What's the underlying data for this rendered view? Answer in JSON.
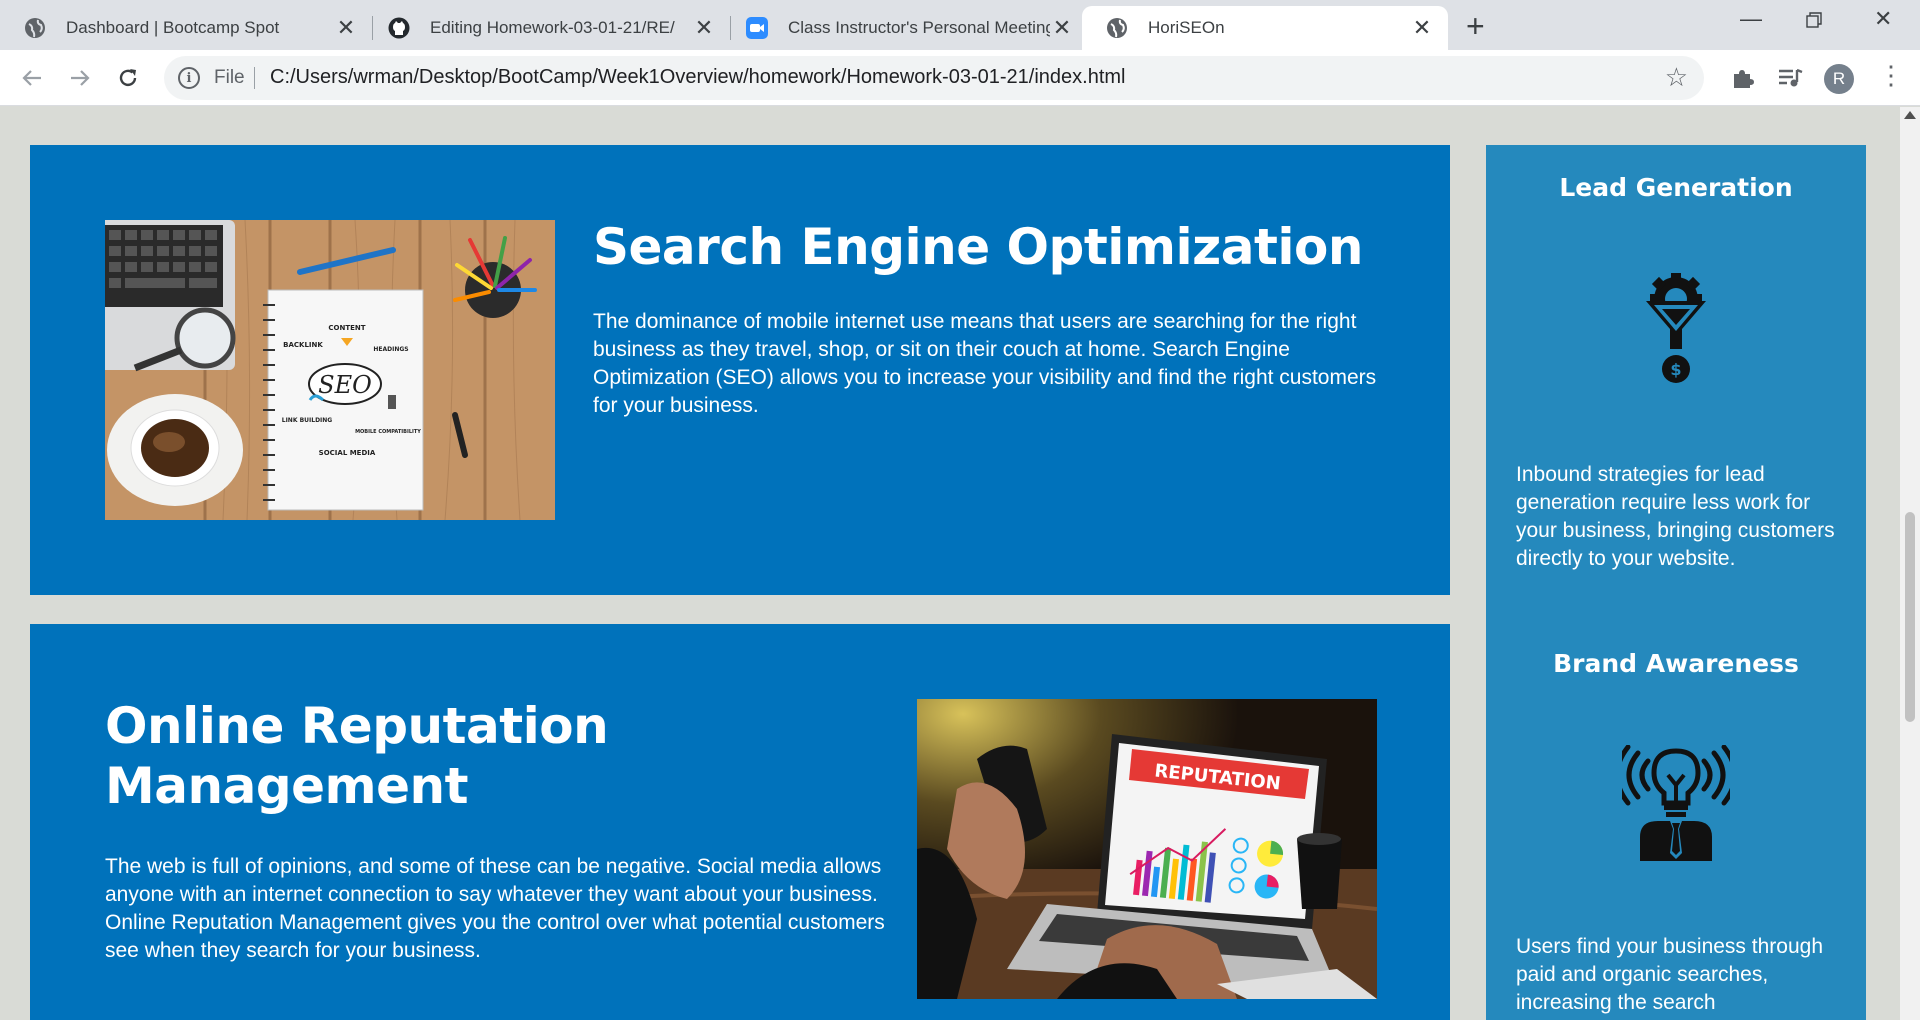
{
  "tabs": [
    {
      "title": "Dashboard | Bootcamp Spot",
      "icon": "globe-icon"
    },
    {
      "title": "Editing Homework-03-01-21/RE/",
      "icon": "github-icon"
    },
    {
      "title": "Class Instructor's Personal Meeting",
      "icon": "zoom-icon"
    },
    {
      "title": "HoriSEOn",
      "icon": "globe-icon"
    }
  ],
  "toolbar": {
    "file_label": "File",
    "url": "C:/Users/wrman/Desktop/BootCamp/Week1Overview/homework/Homework-03-01-21/index.html",
    "avatar_initial": "R"
  },
  "content": {
    "seo": {
      "title": "Search Engine Optimization",
      "text": "The dominance of mobile internet use means that users are searching for the right business as they travel, shop, or sit on their couch at home. Search Engine Optimization (SEO) allows you to increase your visibility and find the right customers for your business.",
      "image_words": [
        "CONTENT",
        "BACKLINK",
        "HEADINGS",
        "SEO",
        "LINK BUILDING",
        "MOBILE COMPATIBILITY",
        "SOCIAL MEDIA"
      ]
    },
    "orm": {
      "title_line1": "Online Reputation",
      "title_line2": "Management",
      "text": "The web is full of opinions, and some of these can be negative. Social media allows anyone with an internet connection to say whatever they want about your business. Online Reputation Management gives you the control over what potential customers see when they search for your business.",
      "image_word": "REPUTATION"
    }
  },
  "sidebar": {
    "lead": {
      "title": "Lead Generation",
      "icon": "lead-funnel-icon",
      "text": "Inbound strategies for lead generation require less work for your business, bringing customers directly to your website."
    },
    "brand": {
      "title": "Brand Awareness",
      "icon": "idea-broadcast-icon",
      "text": "Users find your business through paid and organic searches, increasing the search"
    }
  },
  "colors": {
    "content_blue": "#0072bb",
    "sidebar_blue": "#2589bd",
    "page_bg": "#d9dbd6"
  }
}
